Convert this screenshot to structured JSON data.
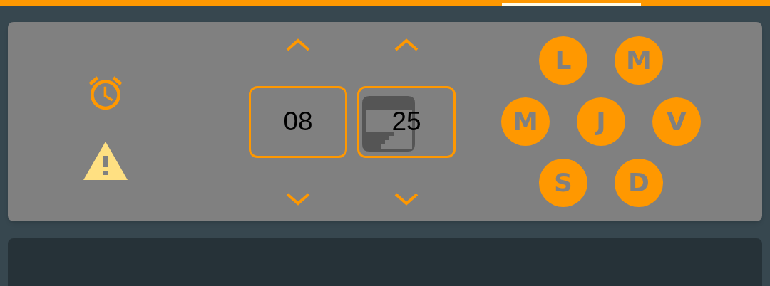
{
  "time": {
    "hour": "08",
    "minute": "25"
  },
  "alarm_days": [
    {
      "label": "L",
      "selected": true
    },
    {
      "label": "M",
      "selected": true
    },
    {
      "label": "M",
      "selected": true
    },
    {
      "label": "J",
      "selected": true
    },
    {
      "label": "V",
      "selected": true
    },
    {
      "label": "S",
      "selected": true
    },
    {
      "label": "D",
      "selected": true
    }
  ]
}
